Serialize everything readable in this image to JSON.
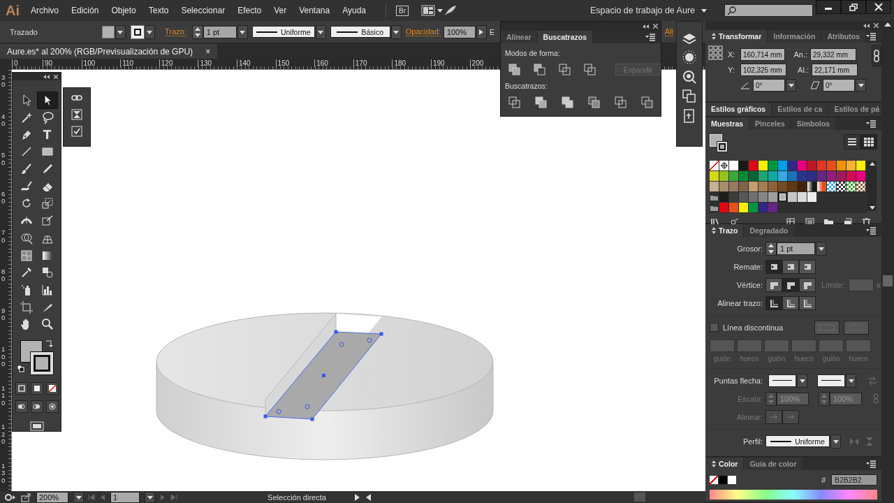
{
  "menu_bar": {
    "logo": "Ai",
    "menus": [
      "Archivo",
      "Edición",
      "Objeto",
      "Texto",
      "Seleccionar",
      "Efecto",
      "Ver",
      "Ventana",
      "Ayuda"
    ],
    "bridge": "Br",
    "workspace": "Espacio de trabajo de Aure"
  },
  "control_bar": {
    "selection": "Trazado",
    "stroke_label": "Trazo:",
    "stroke_weight": "1 pt",
    "profile": "Uniforme",
    "brush": "Básico",
    "opacity_label": "Opacidad:",
    "opacity": "100%",
    "style_label": "E",
    "align_label": "Ali"
  },
  "document_tab": {
    "title": "Aure.es* al 200% (RGB/Previsualización de GPU)",
    "close": "×"
  },
  "rulers": {
    "horizontal": [
      "0",
      "90",
      "100",
      "110",
      "120",
      "130",
      "140",
      "150",
      "160",
      "170",
      "180",
      "190",
      "200"
    ],
    "vertical": [
      "30",
      "40",
      "50",
      "60",
      "70",
      "80",
      "90",
      "100",
      "110",
      "120",
      "130"
    ]
  },
  "tools": [
    {
      "kind": "selection",
      "selected": false
    },
    {
      "kind": "direct-selection",
      "selected": true
    },
    {
      "kind": "magic-wand",
      "selected": false
    },
    {
      "kind": "lasso",
      "selected": false
    },
    {
      "kind": "pen",
      "selected": false
    },
    {
      "kind": "type",
      "glyph": "T",
      "selected": false
    },
    {
      "kind": "line",
      "selected": false
    },
    {
      "kind": "rectangle",
      "selected": false
    },
    {
      "kind": "paintbrush",
      "selected": false
    },
    {
      "kind": "pencil",
      "selected": false
    },
    {
      "kind": "blob-brush",
      "selected": false
    },
    {
      "kind": "eraser",
      "selected": false
    },
    {
      "kind": "rotate",
      "selected": false
    },
    {
      "kind": "scale",
      "selected": false
    },
    {
      "kind": "width",
      "selected": false
    },
    {
      "kind": "free-transform",
      "selected": false
    },
    {
      "kind": "shape-builder",
      "selected": false
    },
    {
      "kind": "perspective",
      "selected": false
    },
    {
      "kind": "mesh",
      "selected": false
    },
    {
      "kind": "gradient",
      "selected": false
    },
    {
      "kind": "eyedropper",
      "selected": false
    },
    {
      "kind": "blend",
      "selected": false
    },
    {
      "kind": "symbol-sprayer",
      "selected": false
    },
    {
      "kind": "column-graph",
      "selected": false
    },
    {
      "kind": "artboard",
      "selected": false
    },
    {
      "kind": "slice",
      "selected": false
    },
    {
      "kind": "hand",
      "selected": false
    },
    {
      "kind": "zoom",
      "selected": false
    }
  ],
  "pathfinder": {
    "tabs": [
      {
        "label": "Alinear",
        "selected": false
      },
      {
        "label": "Buscatrazos",
        "selected": true
      }
    ],
    "shape_modes_label": "Modos de forma:",
    "expand": {
      "label": "Expandir",
      "disabled": true
    },
    "pathfinders_label": "Buscatrazos:"
  },
  "transform": {
    "tabs": [
      {
        "label": "Transformar",
        "selected": true
      },
      {
        "label": "Información",
        "selected": false
      },
      {
        "label": "Atributos",
        "selected": false
      }
    ],
    "x_label": "X:",
    "x": "160,714 mm",
    "w_label": "An.:",
    "w": "29,332 mm",
    "y_label": "Y:",
    "y": "102,325 mm",
    "h_label": "Al.:",
    "h": "22,171 mm",
    "rotate": "0°",
    "shear": "0°"
  },
  "graphic_styles": {
    "tabs": [
      {
        "label": "Estilos gráficos",
        "selected": true
      },
      {
        "label": "Estilos de ca",
        "selected": false
      },
      {
        "label": "Estilos de pá",
        "selected": false
      }
    ]
  },
  "swatches": {
    "tabs": [
      {
        "label": "Muestras",
        "selected": true
      },
      {
        "label": "Pinceles",
        "selected": false
      },
      {
        "label": "Símbolos",
        "selected": false
      }
    ],
    "views": [
      {
        "kind": "list",
        "selected": false
      },
      {
        "kind": "grid",
        "selected": true
      }
    ],
    "rows": [
      [
        {
          "kind": "none",
          "selected": false
        },
        {
          "kind": "registration",
          "selected": false
        },
        {
          "kind": "color",
          "color": "#ffffff",
          "selected": false
        },
        {
          "kind": "color",
          "color": "#1a1a1a",
          "selected": false
        },
        {
          "kind": "color",
          "color": "#e30613",
          "selected": false
        },
        {
          "kind": "color",
          "color": "#ffed00",
          "selected": false
        },
        {
          "kind": "color",
          "color": "#009640",
          "selected": false
        },
        {
          "kind": "color",
          "color": "#009fe3",
          "selected": false
        },
        {
          "kind": "color",
          "color": "#312783",
          "selected": false
        },
        {
          "kind": "color",
          "color": "#e5007d",
          "selected": false
        },
        {
          "kind": "color",
          "color": "#be1622",
          "selected": false
        },
        {
          "kind": "color",
          "color": "#e6332a",
          "selected": false
        },
        {
          "kind": "color",
          "color": "#e94e1b",
          "selected": false
        },
        {
          "kind": "color",
          "color": "#f39200",
          "selected": false
        },
        {
          "kind": "color",
          "color": "#f9b233",
          "selected": false
        },
        {
          "kind": "color",
          "color": "#fcea10",
          "selected": false
        }
      ],
      [
        {
          "kind": "color",
          "color": "#d4d81a",
          "selected": false
        },
        {
          "kind": "color",
          "color": "#95c11f",
          "selected": false
        },
        {
          "kind": "color",
          "color": "#3aaa35",
          "selected": false
        },
        {
          "kind": "color",
          "color": "#008d36",
          "selected": false
        },
        {
          "kind": "color",
          "color": "#006633",
          "selected": false
        },
        {
          "kind": "color",
          "color": "#1da56f",
          "selected": false
        },
        {
          "kind": "color",
          "color": "#13a89e",
          "selected": false
        },
        {
          "kind": "color",
          "color": "#36a9e1",
          "selected": false
        },
        {
          "kind": "color",
          "color": "#1d71b8",
          "selected": false
        },
        {
          "kind": "color",
          "color": "#29348f",
          "selected": false
        },
        {
          "kind": "color",
          "color": "#2d2e83",
          "selected": false
        },
        {
          "kind": "color",
          "color": "#662483",
          "selected": false
        },
        {
          "kind": "color",
          "color": "#951b81",
          "selected": false
        },
        {
          "kind": "color",
          "color": "#a3195b",
          "selected": false
        },
        {
          "kind": "color",
          "color": "#d60b52",
          "selected": false
        },
        {
          "kind": "color",
          "color": "#e6007e",
          "selected": false
        }
      ],
      [
        {
          "kind": "color",
          "color": "#c8b093",
          "selected": false
        },
        {
          "kind": "color",
          "color": "#a88d6a",
          "selected": false
        },
        {
          "kind": "color",
          "color": "#957c5d",
          "selected": false
        },
        {
          "kind": "color",
          "color": "#806448",
          "selected": false
        },
        {
          "kind": "color",
          "color": "#c69c6d",
          "selected": false
        },
        {
          "kind": "color",
          "color": "#a67c52",
          "selected": false
        },
        {
          "kind": "color",
          "color": "#8c6239",
          "selected": false
        },
        {
          "kind": "color",
          "color": "#754c24",
          "selected": false
        },
        {
          "kind": "color",
          "color": "#603813",
          "selected": false
        },
        {
          "kind": "color",
          "color": "#42210b",
          "selected": false
        },
        {
          "kind": "gradient",
          "color": "#1a1a1a",
          "selected": false
        },
        {
          "kind": "gradient",
          "color": "#e94e1b",
          "selected": false
        },
        {
          "kind": "pattern",
          "color": "#36a9e1",
          "selected": false
        },
        {
          "kind": "pattern",
          "color": "#333333",
          "selected": false
        },
        {
          "kind": "pattern",
          "color": "#3aaa35",
          "selected": false
        },
        {
          "kind": "pattern",
          "color": "#8c6239",
          "selected": false
        }
      ],
      [
        {
          "kind": "folder",
          "selected": false
        },
        {
          "kind": "color",
          "color": "#1d1d1b",
          "selected": false
        },
        {
          "kind": "color",
          "color": "#3c3c3b",
          "selected": false
        },
        {
          "kind": "color",
          "color": "#575756",
          "selected": false
        },
        {
          "kind": "color",
          "color": "#706f6f",
          "selected": false
        },
        {
          "kind": "color",
          "color": "#878787",
          "selected": false
        },
        {
          "kind": "color",
          "color": "#9d9d9c",
          "selected": false
        },
        {
          "kind": "color",
          "color": "#b2b2b2",
          "selected": true
        },
        {
          "kind": "color",
          "color": "#c6c6c6",
          "selected": false
        },
        {
          "kind": "color",
          "color": "#dadada",
          "selected": false
        },
        {
          "kind": "color",
          "color": "#ededed",
          "selected": false
        }
      ],
      [
        {
          "kind": "folder",
          "selected": false
        },
        {
          "kind": "color",
          "color": "#e30613",
          "selected": false
        },
        {
          "kind": "color",
          "color": "#e94e1b",
          "selected": false
        },
        {
          "kind": "color",
          "color": "#ffed00",
          "selected": false
        },
        {
          "kind": "color",
          "color": "#009640",
          "selected": false
        },
        {
          "kind": "color",
          "color": "#312783",
          "selected": false
        },
        {
          "kind": "color",
          "color": "#662483",
          "selected": false
        }
      ]
    ]
  },
  "stroke": {
    "tabs": [
      {
        "label": "Trazo",
        "selected": true
      },
      {
        "label": "Degradado",
        "selected": false
      }
    ],
    "weight_label": "Grosor:",
    "weight": "1 pt",
    "cap_label": "Remate:",
    "caps": [
      {
        "selected": true
      },
      {
        "selected": false
      },
      {
        "selected": false
      }
    ],
    "corner_label": "Vértice:",
    "corners": [
      {
        "selected": false
      },
      {
        "selected": true
      },
      {
        "selected": false
      }
    ],
    "limit_label": "Límite:",
    "limit_suffix": "x",
    "limit_disabled": true,
    "align_label": "Alinear trazo:",
    "aligns": [
      {
        "selected": true
      },
      {
        "selected": false
      },
      {
        "selected": false
      }
    ],
    "dashed_label": "Línea discontinua",
    "dashed": false,
    "dash_labels": [
      "guión",
      "hueco",
      "guión",
      "hueco",
      "guión",
      "hueco"
    ],
    "arrowheads_label": "Puntas flecha:",
    "scale_label": "Escala:",
    "scale_start": "100%",
    "scale_end": "100%",
    "arrow_align_label": "Alinear:",
    "profile_label": "Perfil:",
    "profile": "Uniforme"
  },
  "color": {
    "tabs": [
      {
        "label": "Color",
        "selected": true
      },
      {
        "label": "Guía de color",
        "selected": false
      }
    ],
    "hex_label": "#",
    "hex": "B2B2B2"
  },
  "status_bar": {
    "zoom": "200%",
    "artboard": "1",
    "status": "Selección directa"
  }
}
